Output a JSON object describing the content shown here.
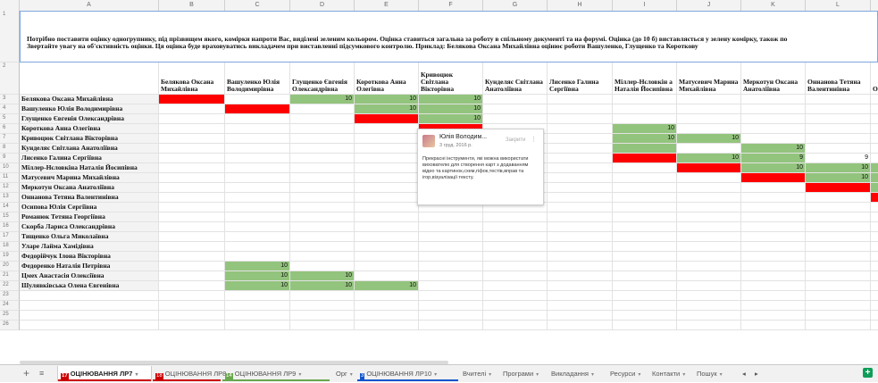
{
  "columns": [
    "A",
    "B",
    "C",
    "D",
    "E",
    "F",
    "G",
    "H",
    "I",
    "J",
    "K",
    "L",
    "M"
  ],
  "row_numbers": [
    "1",
    "2",
    "3",
    "4",
    "5",
    "6",
    "7",
    "8",
    "9",
    "10",
    "11",
    "12",
    "13",
    "14",
    "15",
    "16",
    "17",
    "18",
    "19",
    "20",
    "21",
    "22",
    "23",
    "24",
    "25",
    "26"
  ],
  "instructions": {
    "line1": "Потрібно поставити оцінку одногрупнику, під прізвищем якого, комірки напроти Вас, виділені зеленим кольором. Оцінка ставиться загальна за роботу в спільному документі та на форумі. Оцінка (до 10 б) виставляється у зелену комірку, також по",
    "line2": "Звертайте увагу на об'єктивність оцінки. Ця оцінка буде враховуватись викладачем при виставленні підсумкового контролю. Приклад: Белякова Оксана Михайлівна оцінює роботи Вашуленко, Глущенко та Короткову"
  },
  "headers": [
    "Белякова Оксана Михайлівна",
    "Вашуленко Юлія Володимирівна",
    "Глущенко Євгенія Олександрівна",
    "Короткова Анна Олегівна",
    "Кривоцюк Світлана Вікторівна",
    "Кунделяє Світлана Анатоліївна",
    "Лисенко Галина Сергіївна",
    "Міллер-Нєловкін а Наталія Йосипівна",
    "Матусевич Марина Михайлівна",
    "Меркотун Оксана Анатоліївна",
    "Оннанова Тетяна Валентинівна",
    "О С"
  ],
  "students": [
    "Белякова Оксана Михайлівна",
    "Вашуленко Юлія Володимирівна",
    "Глущенко Євгенія Олександрівна",
    "Короткова Анна Олегівна",
    "Кривоцюк Світлана Вікторівна",
    "Кунделяє Світлана Анатоліївна",
    "Лисенко Галина Сергіївна",
    "Міллер-Нєловкіна Наталія Йосипівна",
    "Матусевич Марина Михайлівна",
    "Меркотун Оксана Анатоліївна",
    "Оннанова Тетяна Валентинівна",
    "Осипова Юлія Сергіївна",
    "Романюк Тетяна Георгіївна",
    "Скорба Лариса Олександрівна",
    "Тищенко Ольга Миколаївна",
    "Уларе Лайма Хамідівна",
    "Федорійчук Ілона Вікторівна",
    "Федоренко Наталія Петрівна",
    "Цмех Анастасія Олексіївна",
    "Шулявківська Олена Євгенівна"
  ],
  "grid": [
    [
      "red",
      "",
      "green:10",
      "green:10",
      "green:10",
      "",
      "",
      "",
      "",
      "",
      "",
      ""
    ],
    [
      "",
      "red",
      "",
      "green:10",
      "green:10",
      "",
      "",
      "",
      "",
      "",
      "",
      ""
    ],
    [
      "",
      "",
      "",
      "red",
      "green:10",
      "",
      "",
      "",
      "",
      "",
      "",
      ""
    ],
    [
      "",
      "",
      "",
      "",
      "red",
      "",
      "",
      "green:10",
      "",
      "",
      "",
      ""
    ],
    [
      "",
      "",
      "",
      "",
      "",
      "",
      "",
      "green:10",
      "green:10",
      "",
      "",
      ""
    ],
    [
      "",
      "",
      "",
      "",
      "",
      "",
      "",
      "green",
      "",
      "green:10",
      "",
      ""
    ],
    [
      "",
      "",
      "",
      "",
      "",
      "",
      "",
      "red",
      "green:10",
      "green:9",
      "9",
      ""
    ],
    [
      "",
      "",
      "",
      "",
      "",
      "",
      "",
      "",
      "red",
      "green:10",
      "green:10",
      "green:10"
    ],
    [
      "",
      "",
      "",
      "",
      "",
      "",
      "",
      "",
      "",
      "red",
      "green:10",
      "green:10"
    ],
    [
      "",
      "",
      "",
      "",
      "",
      "",
      "",
      "",
      "",
      "",
      "red",
      "green:10"
    ],
    [
      "",
      "",
      "",
      "",
      "",
      "",
      "",
      "",
      "",
      "",
      "",
      "red"
    ],
    [
      "",
      "",
      "",
      "",
      "",
      "",
      "",
      "",
      "",
      "",
      "",
      ""
    ],
    [
      "",
      "",
      "",
      "",
      "",
      "",
      "",
      "",
      "",
      "",
      "",
      ""
    ],
    [
      "",
      "",
      "",
      "",
      "",
      "",
      "",
      "",
      "",
      "",
      "",
      ""
    ],
    [
      "",
      "",
      "",
      "",
      "",
      "",
      "",
      "",
      "",
      "",
      "",
      ""
    ],
    [
      "",
      "",
      "",
      "",
      "",
      "",
      "",
      "",
      "",
      "",
      "",
      ""
    ],
    [
      "",
      "",
      "",
      "",
      "",
      "",
      "",
      "",
      "",
      "",
      "",
      ""
    ],
    [
      "",
      "green:10",
      "",
      "",
      "",
      "",
      "",
      "",
      "",
      "",
      "",
      ""
    ],
    [
      "",
      "green:10",
      "green:10",
      "",
      "",
      "",
      "",
      "",
      "",
      "",
      "",
      ""
    ],
    [
      "",
      "green:10",
      "green:10",
      "green:10",
      "",
      "",
      "",
      "",
      "",
      "",
      "",
      ""
    ]
  ],
  "comment": {
    "author": "Юлія Володим...",
    "date": "3 груд. 2016 р.",
    "close_label": "Закрити",
    "more": "⋮",
    "text": "Прекрасні інструменти, які можна використати вихователю для створення карт з додаванням відео та картинок,схем,гіфок,тестів,вправ та ігор,візуалізації тексту."
  },
  "tabs": [
    {
      "label": "ОЦІНЮВАННЯ ЛР7",
      "num": "17",
      "active": true,
      "color": "#cc0000"
    },
    {
      "label": "ОЦІНЮВАННЯ ЛР8",
      "num": "18",
      "active": false,
      "color": "#cc0000"
    },
    {
      "label": "ОЦІНЮВАННЯ ЛР9",
      "num": "14",
      "active": false,
      "color": "#6aa84f"
    },
    {
      "label": "Орг",
      "num": "",
      "active": false,
      "color": ""
    },
    {
      "label": "ОЦІНЮВАННЯ ЛР10",
      "num": "3",
      "active": false,
      "color": "#1155cc"
    },
    {
      "label": "Вчителі",
      "num": "",
      "active": false,
      "color": ""
    },
    {
      "label": "Програми",
      "num": "",
      "active": false,
      "color": ""
    },
    {
      "label": "Викладання",
      "num": "",
      "active": false,
      "color": ""
    },
    {
      "label": "Ресурси",
      "num": "",
      "active": false,
      "color": ""
    },
    {
      "label": "Контакти",
      "num": "",
      "active": false,
      "color": ""
    },
    {
      "label": "Пошук",
      "num": "",
      "active": false,
      "color": ""
    }
  ],
  "tab_bar": {
    "add": "+",
    "menu": "≡",
    "dropdown": "▾",
    "nav_left": "◂",
    "nav_right": "▸",
    "explore": "+"
  }
}
